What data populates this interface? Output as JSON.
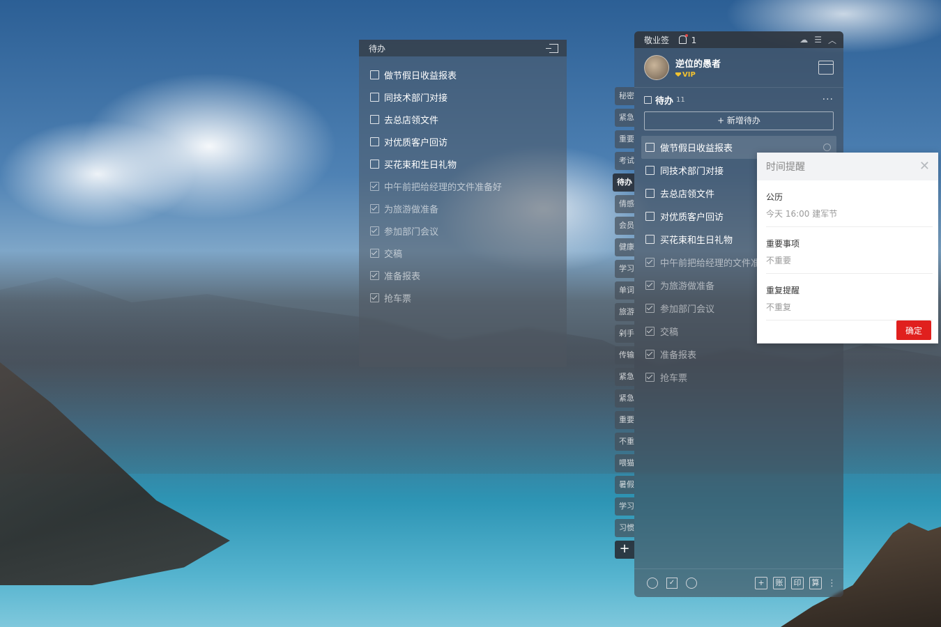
{
  "left_note": {
    "title": "待办",
    "items": [
      {
        "label": "做节假日收益报表",
        "done": false
      },
      {
        "label": "同技术部门对接",
        "done": false
      },
      {
        "label": "去总店领文件",
        "done": false
      },
      {
        "label": "对优质客户回访",
        "done": false
      },
      {
        "label": "买花束和生日礼物",
        "done": false
      },
      {
        "label": "中午前把给经理的文件准备好",
        "done": true
      },
      {
        "label": "为旅游做准备",
        "done": true
      },
      {
        "label": "参加部门会议",
        "done": true
      },
      {
        "label": "交稿",
        "done": true
      },
      {
        "label": "准备报表",
        "done": true
      },
      {
        "label": "抢车票",
        "done": true
      }
    ]
  },
  "side_tabs": [
    "秘密",
    "紧急",
    "重要",
    "考试",
    "待办",
    "倩感",
    "会员",
    "健康",
    "学习",
    "单词",
    "旅游",
    "剁手",
    "传输",
    "紧急",
    "紧急",
    "重要",
    "不重",
    "喂猫",
    "暑假",
    "学习",
    "习惯"
  ],
  "side_tab_active_index": 4,
  "side_add_label": "+",
  "main_panel": {
    "app_title": "敬业签",
    "notification_count": "1",
    "user_name": "逆位的愚者",
    "vip_label": "VIP",
    "section_title": "待办",
    "section_count": "11",
    "add_button_label": "+ 新增待办",
    "items": [
      {
        "label": "做节假日收益报表",
        "done": false
      },
      {
        "label": "同技术部门对接",
        "done": false
      },
      {
        "label": "去总店领文件",
        "done": false
      },
      {
        "label": "对优质客户回访",
        "done": false
      },
      {
        "label": "买花束和生日礼物",
        "done": false
      },
      {
        "label": "中午前把给经理的文件准备好",
        "done": true
      },
      {
        "label": "为旅游做准备",
        "done": true
      },
      {
        "label": "参加部门会议",
        "done": true
      },
      {
        "label": "交稿",
        "done": true
      },
      {
        "label": "准备报表",
        "done": true
      },
      {
        "label": "抢车票",
        "done": true
      }
    ],
    "bottom_right_buttons": [
      "+",
      "账",
      "印",
      "算"
    ]
  },
  "reminder_popup": {
    "title": "时间提醒",
    "calendar_label": "公历",
    "calendar_value": "今天  16:00  建军节",
    "important_label": "重要事项",
    "important_value": "不重要",
    "repeat_label": "重复提醒",
    "repeat_value": "不重复",
    "confirm_label": "确定"
  }
}
